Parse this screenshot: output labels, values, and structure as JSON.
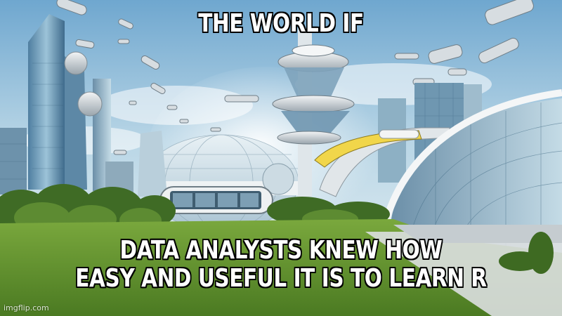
{
  "meme": {
    "top_text": "THE WORLD IF",
    "bottom_line_1": "DATA ANALYSTS KNEW HOW",
    "bottom_line_2": "EASY AND USEFUL IT IS TO LEARN R",
    "watermark": "imgflip.com"
  },
  "colors": {
    "sky_top": "#7fb3d6",
    "sky_bottom": "#e6f0f4",
    "grass": "#5f8f2c",
    "building_glass": "#8fb6cc",
    "caption_text": "#ffffff",
    "caption_outline": "#000000"
  },
  "background": {
    "subject": "futuristic utopian city"
  }
}
